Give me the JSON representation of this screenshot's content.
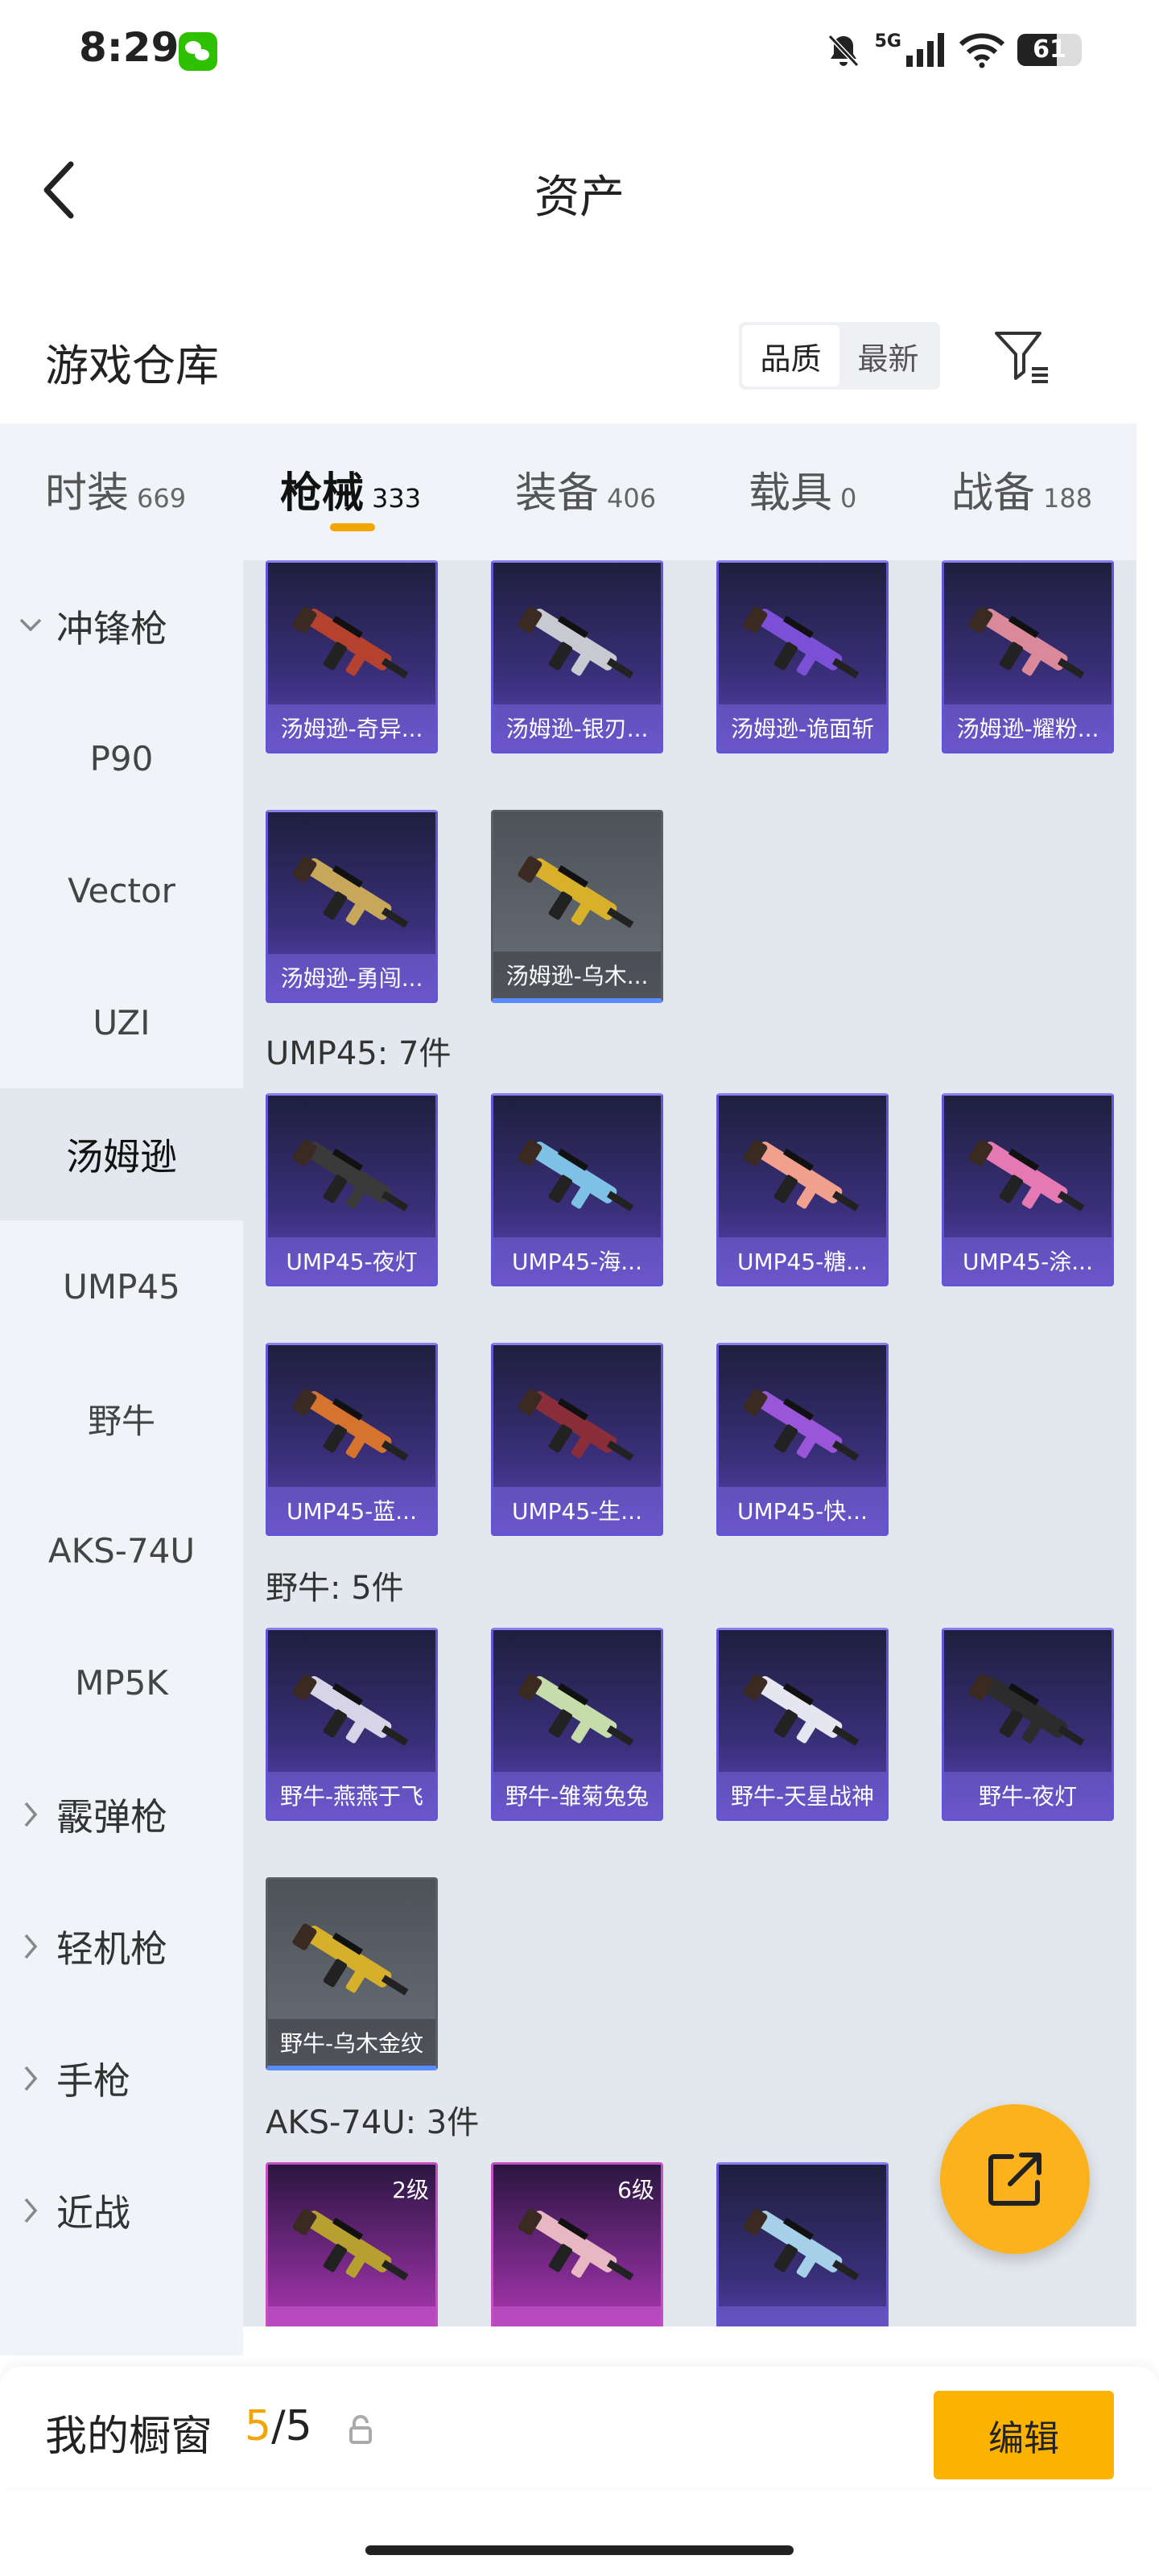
{
  "status_bar": {
    "time": "8:29",
    "network": "5G",
    "battery": "61",
    "battery_level": 0.61
  },
  "header": {
    "title": "资产"
  },
  "section": {
    "title": "游戏仓库",
    "sort_options": [
      "品质",
      "最新"
    ],
    "active_sort": 0
  },
  "tabs": [
    {
      "label": "时装",
      "count": "669"
    },
    {
      "label": "枪械",
      "count": "333"
    },
    {
      "label": "装备",
      "count": "406"
    },
    {
      "label": "载具",
      "count": "0"
    },
    {
      "label": "战备",
      "count": "188"
    }
  ],
  "active_tab": 1,
  "sidenav": [
    {
      "label": "冲锋枪",
      "type": "parent"
    },
    {
      "label": "P90",
      "type": "child"
    },
    {
      "label": "Vector",
      "type": "child"
    },
    {
      "label": "UZI",
      "type": "child"
    },
    {
      "label": "汤姆逊",
      "type": "child",
      "active": true
    },
    {
      "label": "UMP45",
      "type": "child"
    },
    {
      "label": "野牛",
      "type": "child"
    },
    {
      "label": "AKS-74U",
      "type": "child"
    },
    {
      "label": "MP5K",
      "type": "child"
    },
    {
      "label": "霰弹枪",
      "type": "parent"
    },
    {
      "label": "轻机枪",
      "type": "parent"
    },
    {
      "label": "手枪",
      "type": "parent"
    },
    {
      "label": "近战",
      "type": "parent"
    }
  ],
  "groups": [
    {
      "title": "",
      "items": [
        {
          "name": "汤姆逊-奇异...",
          "style": "blue",
          "gun_color": "#b5422e"
        },
        {
          "name": "汤姆逊-银刃...",
          "style": "blue",
          "gun_color": "#c9c9d2"
        },
        {
          "name": "汤姆逊-诡面斩",
          "style": "blue",
          "gun_color": "#7b4fd6"
        },
        {
          "name": "汤姆逊-耀粉...",
          "style": "blue",
          "gun_color": "#d9899a"
        },
        {
          "name": "汤姆逊-勇闯...",
          "style": "blue",
          "gun_color": "#c7a85a"
        },
        {
          "name": "汤姆逊-乌木...",
          "style": "gray",
          "gun_color": "#d9b02a"
        }
      ]
    },
    {
      "title": "UMP45: 7件",
      "items": [
        {
          "name": "UMP45-夜灯",
          "style": "blue",
          "gun_color": "#3a3a3a"
        },
        {
          "name": "UMP45-海...",
          "style": "blue",
          "gun_color": "#7fc0e6"
        },
        {
          "name": "UMP45-糖...",
          "style": "blue",
          "gun_color": "#f0a08c"
        },
        {
          "name": "UMP45-涂...",
          "style": "blue",
          "gun_color": "#e479b4"
        },
        {
          "name": "UMP45-蓝...",
          "style": "blue",
          "gun_color": "#d6732e"
        },
        {
          "name": "UMP45-生...",
          "style": "blue",
          "gun_color": "#8a2e3a"
        },
        {
          "name": "UMP45-快...",
          "style": "blue",
          "gun_color": "#9a56d8"
        }
      ]
    },
    {
      "title": "野牛: 5件",
      "items": [
        {
          "name": "野牛-燕燕于飞",
          "style": "blue",
          "gun_color": "#d8d4e8"
        },
        {
          "name": "野牛-雏菊兔兔",
          "style": "blue",
          "gun_color": "#c6dcaa"
        },
        {
          "name": "野牛-天星战神",
          "style": "blue",
          "gun_color": "#e6e6f0"
        },
        {
          "name": "野牛-夜灯",
          "style": "blue",
          "gun_color": "#2c2c2c"
        },
        {
          "name": "野牛-乌木金纹",
          "style": "gray",
          "gun_color": "#d6b02a"
        }
      ]
    },
    {
      "title": "AKS-74U: 3件",
      "items": [
        {
          "name": "",
          "style": "purple",
          "level": "2级",
          "gun_color": "#b8a030"
        },
        {
          "name": "",
          "style": "purple",
          "level": "6级",
          "gun_color": "#e8b7c4"
        },
        {
          "name": "",
          "style": "blue",
          "gun_color": "#a6d0ea"
        }
      ]
    }
  ],
  "bottom_bar": {
    "label": "我的橱窗",
    "current": "5",
    "total": "5",
    "edit_label": "编辑"
  },
  "colors": {
    "accent": "#f5a500",
    "panel": "#f0f4f8",
    "content_bg": "#e3e8ee"
  }
}
